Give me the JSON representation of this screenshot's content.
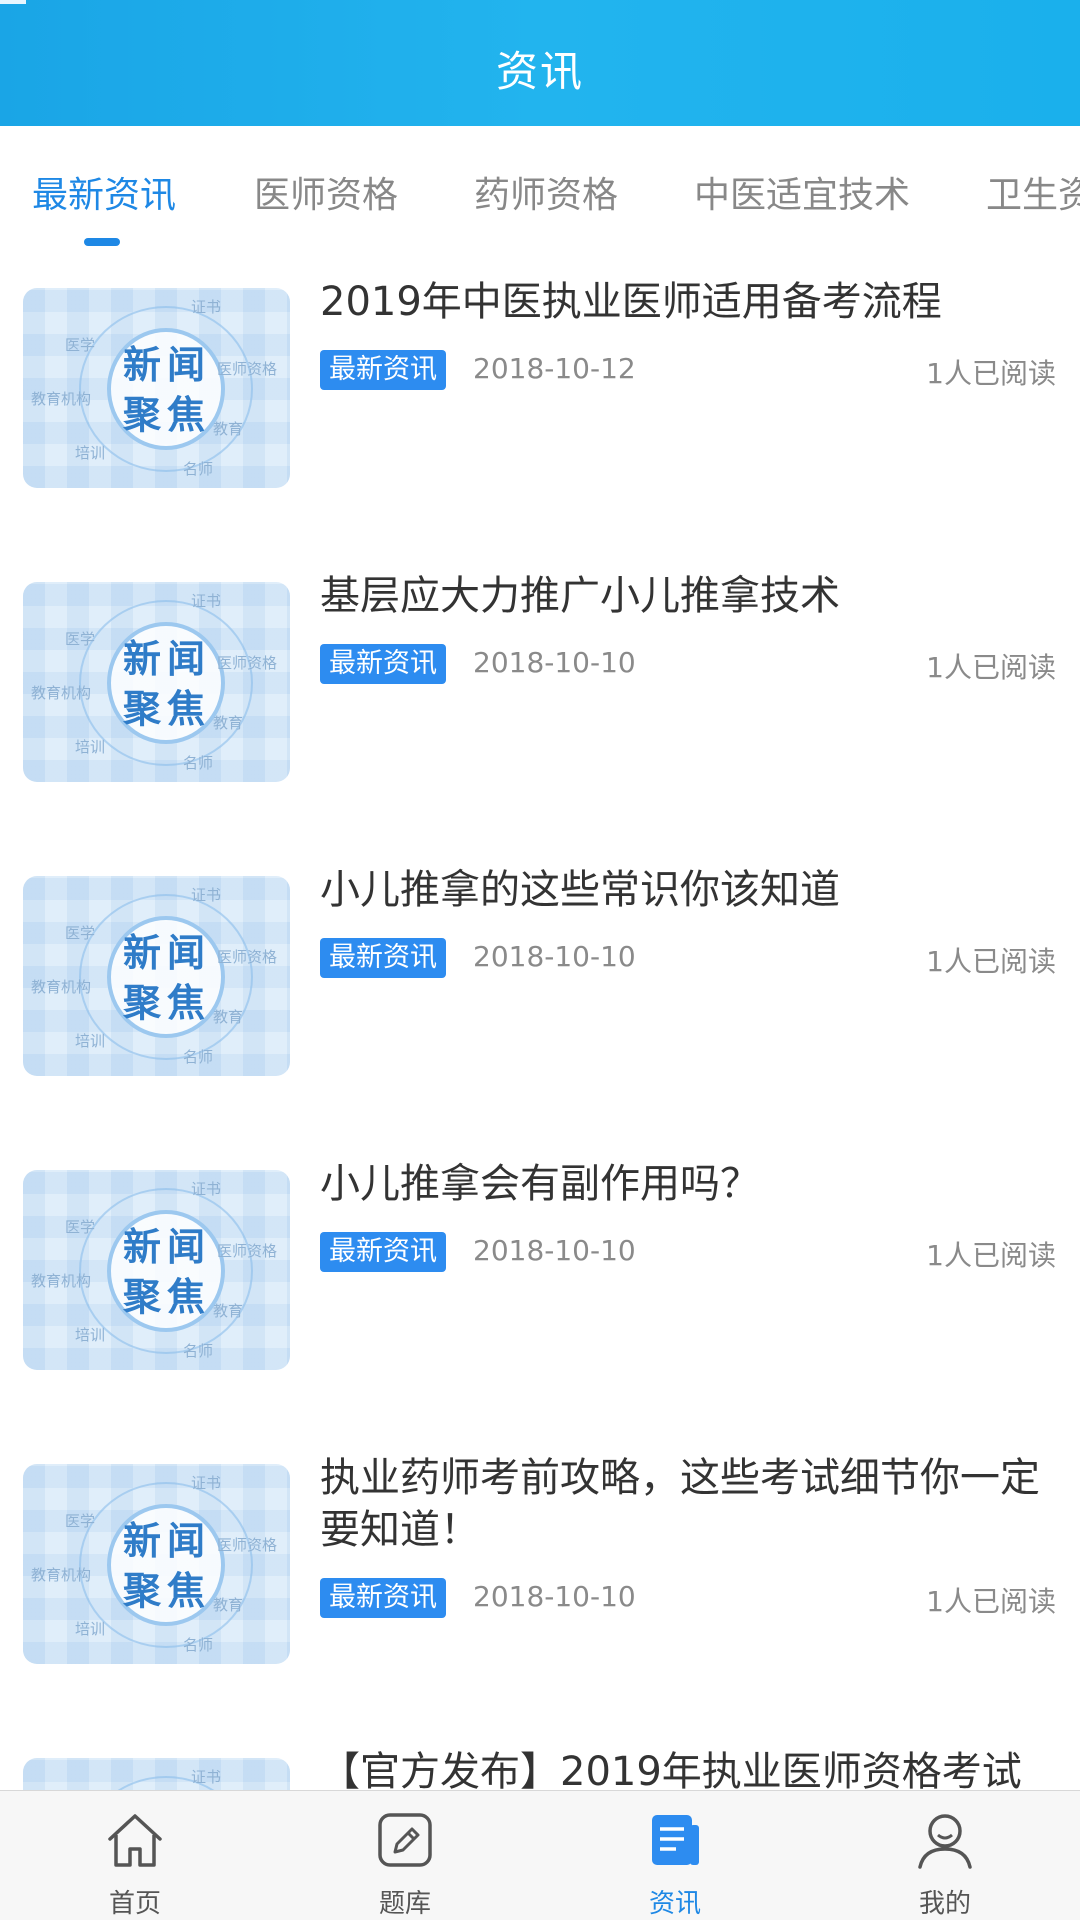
{
  "header": {
    "title": "资讯"
  },
  "tabs": [
    {
      "label": "最新资讯",
      "active": true
    },
    {
      "label": "医师资格",
      "active": false
    },
    {
      "label": "药师资格",
      "active": false
    },
    {
      "label": "中医适宜技术",
      "active": false
    },
    {
      "label": "卫生资",
      "active": false
    }
  ],
  "thumbnail": {
    "main_text": "新闻聚焦",
    "tags": [
      "证书",
      "医学",
      "医师资格",
      "教育机构",
      "教育",
      "培训",
      "名师"
    ]
  },
  "articles": [
    {
      "title": "2019年中医执业医师适用备考流程",
      "category": "最新资讯",
      "date": "2018-10-12",
      "reads": "1人已阅读"
    },
    {
      "title": "基层应大力推广小儿推拿技术",
      "category": "最新资讯",
      "date": "2018-10-10",
      "reads": "1人已阅读"
    },
    {
      "title": "小儿推拿的这些常识你该知道",
      "category": "最新资讯",
      "date": "2018-10-10",
      "reads": "1人已阅读"
    },
    {
      "title": "小儿推拿会有副作用吗？",
      "category": "最新资讯",
      "date": "2018-10-10",
      "reads": "1人已阅读"
    },
    {
      "title": "执业药师考前攻略，这些考试细节你一定要知道！",
      "category": "最新资讯",
      "date": "2018-10-10",
      "reads": "1人已阅读"
    },
    {
      "title": "【官方发布】2019年执业医师资格考试",
      "category": "",
      "date": "",
      "reads": ""
    }
  ],
  "tabbar": [
    {
      "label": "首页",
      "icon": "home-icon",
      "active": false
    },
    {
      "label": "题库",
      "icon": "pencil-icon",
      "active": false
    },
    {
      "label": "资讯",
      "icon": "news-icon",
      "active": true
    },
    {
      "label": "我的",
      "icon": "user-icon",
      "active": false
    }
  ],
  "colors": {
    "header": "#1aa5e6",
    "accent": "#1e88e5",
    "badge": "#2d8cf0"
  }
}
